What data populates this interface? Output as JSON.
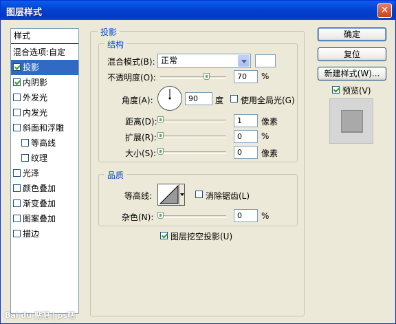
{
  "window": {
    "title": "图层样式",
    "close_glyph": "✕"
  },
  "styles": {
    "header": "样式",
    "items": [
      {
        "label": "混合选项:自定",
        "checkbox": false,
        "checked": false,
        "selected": false,
        "indent": false
      },
      {
        "label": "投影",
        "checkbox": true,
        "checked": true,
        "selected": true,
        "indent": false
      },
      {
        "label": "内阴影",
        "checkbox": true,
        "checked": true,
        "selected": false,
        "indent": false
      },
      {
        "label": "外发光",
        "checkbox": true,
        "checked": false,
        "selected": false,
        "indent": false
      },
      {
        "label": "内发光",
        "checkbox": true,
        "checked": false,
        "selected": false,
        "indent": false
      },
      {
        "label": "斜面和浮雕",
        "checkbox": true,
        "checked": false,
        "selected": false,
        "indent": false
      },
      {
        "label": "等高线",
        "checkbox": true,
        "checked": false,
        "selected": false,
        "indent": true
      },
      {
        "label": "纹理",
        "checkbox": true,
        "checked": false,
        "selected": false,
        "indent": true
      },
      {
        "label": "光泽",
        "checkbox": true,
        "checked": false,
        "selected": false,
        "indent": false
      },
      {
        "label": "颜色叠加",
        "checkbox": true,
        "checked": false,
        "selected": false,
        "indent": false
      },
      {
        "label": "渐变叠加",
        "checkbox": true,
        "checked": false,
        "selected": false,
        "indent": false
      },
      {
        "label": "图案叠加",
        "checkbox": true,
        "checked": false,
        "selected": false,
        "indent": false
      },
      {
        "label": "描边",
        "checkbox": true,
        "checked": false,
        "selected": false,
        "indent": false
      }
    ]
  },
  "shadow": {
    "section_title": "投影",
    "structure_title": "结构",
    "blend_mode_label": "混合模式(B):",
    "blend_mode_value": "正常",
    "opacity_label": "不透明度(O):",
    "opacity_value": "70",
    "opacity_unit": "%",
    "opacity_level": 0.7,
    "angle_label": "角度(A):",
    "angle_value": "90",
    "angle_unit": "度",
    "global_light_label": "使用全局光(G)",
    "distance_label": "距离(D):",
    "distance_value": "1",
    "distance_unit": "像素",
    "spread_label": "扩展(R):",
    "spread_value": "0",
    "spread_unit": "%",
    "size_label": "大小(S):",
    "size_value": "0",
    "size_unit": "像素",
    "quality_title": "品质",
    "contour_label": "等高线:",
    "antialias_label": "消除锯齿(L)",
    "noise_label": "杂色(N):",
    "noise_value": "0",
    "noise_unit": "%",
    "knockout_label": "图层挖空投影(U)"
  },
  "buttons": {
    "ok": "确定",
    "reset": "复位",
    "new_style": "新建样式(W)...",
    "preview": "预览(V)"
  },
  "watermark": "Bai du 贴吧 | ps吧"
}
